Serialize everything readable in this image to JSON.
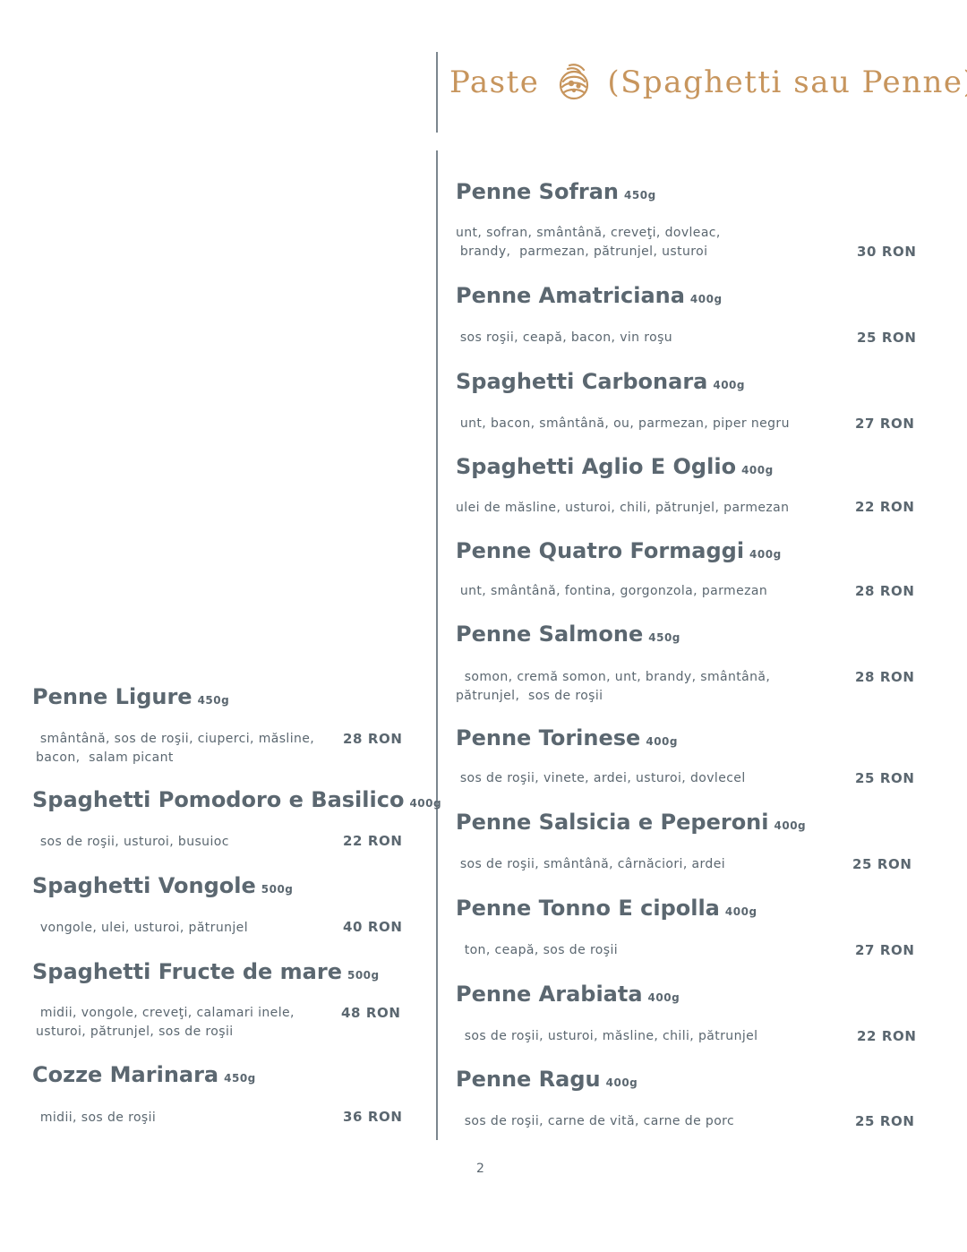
{
  "section": {
    "title_left": "Paste",
    "title_right": "(Spaghetti sau Penne)",
    "accent_color": "#c7955d",
    "icon": "pasta-bowl-icon"
  },
  "left_items": [
    {
      "name": "Penne Ligure",
      "weight": "450g",
      "desc": " smântână, sos de roşii, ciuperci, măsline,\nbacon,  salam picant",
      "price": "28 RON"
    },
    {
      "name": "Spaghetti Pomodoro e Basilico",
      "weight": "400g",
      "desc": " sos de roşii, usturoi, busuioc",
      "price": "22 RON"
    },
    {
      "name": "Spaghetti Vongole",
      "weight": "500g",
      "desc": " vongole, ulei, usturoi, pătrunjel",
      "price": "40 RON"
    },
    {
      "name": "Spaghetti Fructe de mare",
      "weight": "500g",
      "desc": " midii, vongole, creveţi, calamari inele,\nusturoi, pătrunjel, sos de roşii",
      "price": "48 RON"
    },
    {
      "name": "Cozze Marinara",
      "weight": "450g",
      "desc": " midii, sos de roşii",
      "price": "36 RON"
    }
  ],
  "right_items": [
    {
      "name": "Penne Sofran",
      "weight": "450g",
      "desc": "unt, sofran, smântână, creveţi, dovleac,\n brandy,  parmezan, pătrunjel, usturoi",
      "price": "30 RON"
    },
    {
      "name": "Penne Amatriciana",
      "weight": "400g",
      "desc": " sos roşii, ceapă, bacon, vin roşu",
      "price": "25 RON"
    },
    {
      "name": "Spaghetti Carbonara",
      "weight": "400g",
      "desc": " unt, bacon, smântână, ou, parmezan, piper negru",
      "price": "27 RON"
    },
    {
      "name": "Spaghetti Aglio E Oglio",
      "weight": "400g",
      "desc": "ulei de măsline, usturoi, chili, pătrunjel, parmezan",
      "price": "22 RON"
    },
    {
      "name": "Penne Quatro Formaggi",
      "weight": "400g",
      "desc": " unt, smântână, fontina, gorgonzola, parmezan",
      "price": "28 RON"
    },
    {
      "name": "Penne Salmone",
      "weight": "450g",
      "desc": "  somon, cremă somon, unt, brandy, smântână,\npătrunjel,  sos de roşii",
      "price": "28 RON"
    },
    {
      "name": "Penne Torinese",
      "weight": "400g",
      "desc": " sos de roşii, vinete, ardei, usturoi, dovlecel",
      "price": "25 RON"
    },
    {
      "name": "Penne Salsicia e Peperoni",
      "weight": "400g",
      "desc": " sos de roşii, smântână, cârnăciori, ardei",
      "price": "25 RON"
    },
    {
      "name": "Penne Tonno E cipolla",
      "weight": "400g",
      "desc": "  ton, ceapă, sos de roşii",
      "price": "27 RON"
    },
    {
      "name": "Penne Arabiata",
      "weight": "400g",
      "desc": "  sos de roşii, usturoi, măsline, chili, pătrunjel",
      "price": "22 RON"
    },
    {
      "name": "Penne Ragu",
      "weight": "400g",
      "desc": "  sos de roşii, carne de vită, carne de porc",
      "price": "25 RON"
    }
  ],
  "page_number": "2"
}
